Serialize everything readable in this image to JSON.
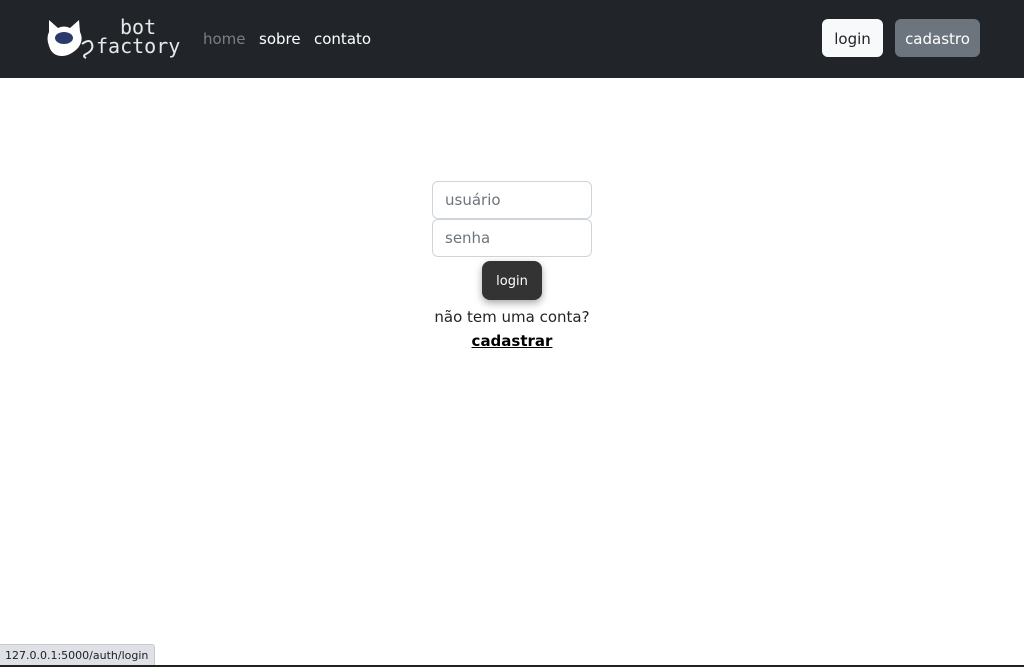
{
  "navbar": {
    "logo": {
      "line1": "bot",
      "line2": "factory",
      "icon": "cat-head-icon"
    },
    "links": [
      {
        "label": "home",
        "active": true
      },
      {
        "label": "sobre",
        "active": false
      },
      {
        "label": "contato",
        "active": false
      }
    ],
    "login_button": "login",
    "signup_button": "cadastro"
  },
  "login_form": {
    "username_placeholder": "usuário",
    "username_value": "",
    "password_placeholder": "senha",
    "password_value": "",
    "submit_label": "login",
    "no_account_text": "não tem uma conta?",
    "register_link": "cadastrar"
  },
  "status_bar": {
    "url": "127.0.0.1:5000/auth/login"
  },
  "colors": {
    "navbar_bg": "#212529",
    "active_link": "#7b7f84",
    "signup_button_bg": "#6c757d",
    "submit_button_bg": "#333333"
  }
}
